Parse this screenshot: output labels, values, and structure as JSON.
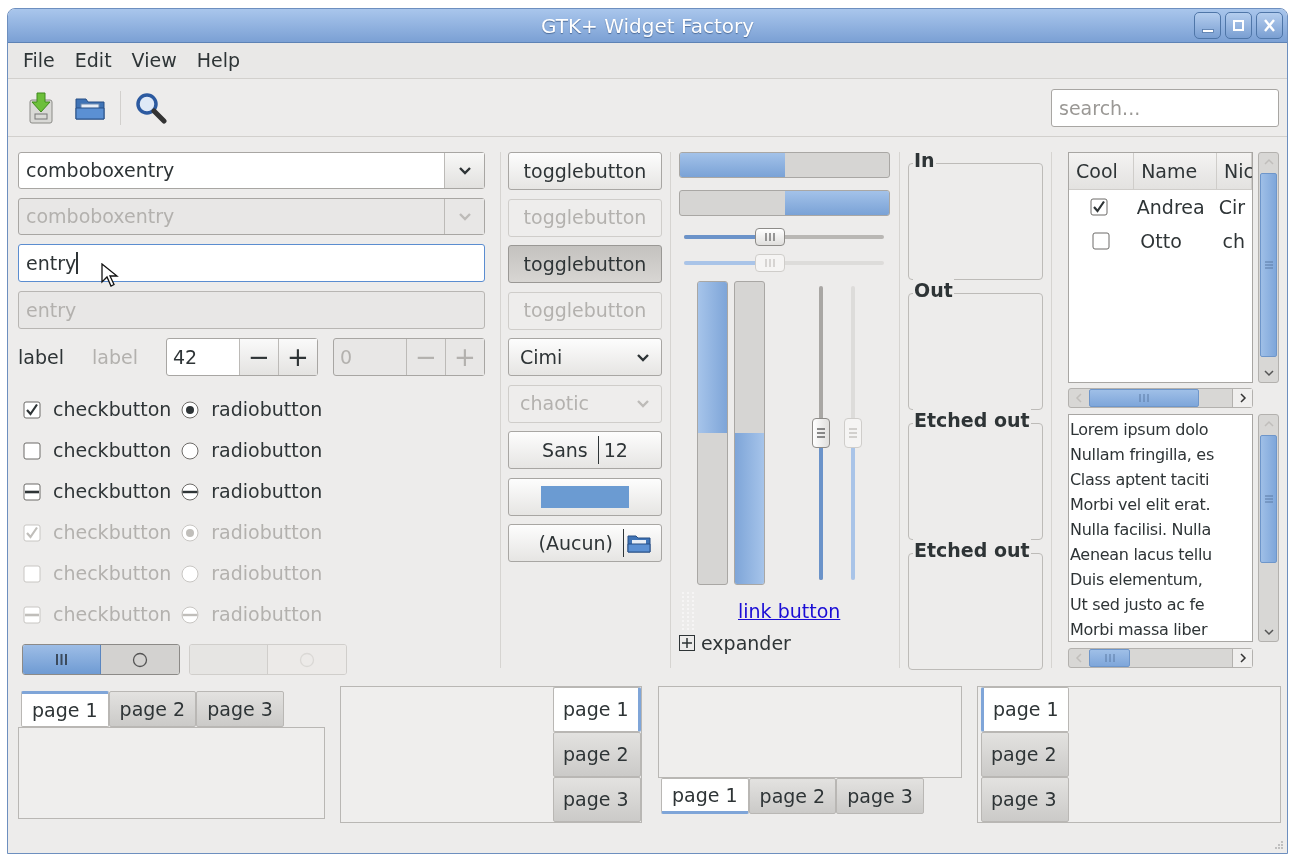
{
  "window": {
    "title": "GTK+ Widget Factory"
  },
  "menu": [
    "File",
    "Edit",
    "View",
    "Help"
  ],
  "toolbar": {
    "search": {
      "placeholder": "search..."
    }
  },
  "combo_entries": [
    {
      "value": "comboboxentry",
      "disabled": false
    },
    {
      "value": "comboboxentry",
      "disabled": true
    }
  ],
  "entries": [
    {
      "value": "entry",
      "disabled": false,
      "focused": true
    },
    {
      "value": "entry",
      "disabled": true,
      "focused": false
    }
  ],
  "labels": [
    {
      "text": "label",
      "disabled": false
    },
    {
      "text": "label",
      "disabled": true
    }
  ],
  "spin_buttons": [
    {
      "value": "42",
      "minus": "−",
      "plus": "+",
      "disabled": false
    },
    {
      "value": "0",
      "minus": "−",
      "plus": "+",
      "disabled": true
    }
  ],
  "check_rows": [
    {
      "check": {
        "label": "checkbutton",
        "checked": true,
        "inconsistent": false
      },
      "radio": {
        "label": "radiobutton",
        "checked": true,
        "inconsistent": false
      },
      "disabled": false
    },
    {
      "check": {
        "label": "checkbutton",
        "checked": false,
        "inconsistent": false
      },
      "radio": {
        "label": "radiobutton",
        "checked": false,
        "inconsistent": false
      },
      "disabled": false
    },
    {
      "check": {
        "label": "checkbutton",
        "inconsistent": true
      },
      "radio": {
        "label": "radiobutton",
        "inconsistent": true
      },
      "disabled": false
    },
    {
      "check": {
        "label": "checkbutton",
        "checked": true,
        "inconsistent": false
      },
      "radio": {
        "label": "radiobutton",
        "checked": true,
        "inconsistent": false
      },
      "disabled": true
    },
    {
      "check": {
        "label": "checkbutton",
        "checked": false,
        "inconsistent": false
      },
      "radio": {
        "label": "radiobutton",
        "checked": false,
        "inconsistent": false
      },
      "disabled": true
    },
    {
      "check": {
        "label": "checkbutton",
        "inconsistent": true
      },
      "radio": {
        "label": "radiobutton",
        "inconsistent": true
      },
      "disabled": true
    }
  ],
  "switches": [
    {
      "on": true,
      "disabled": false
    },
    {
      "on": false,
      "disabled": true
    }
  ],
  "toggle_buttons": [
    {
      "label": "togglebutton",
      "active": false,
      "disabled": false
    },
    {
      "label": "togglebutton",
      "active": false,
      "disabled": true
    },
    {
      "label": "togglebutton",
      "active": true,
      "disabled": false
    },
    {
      "label": "togglebutton",
      "active": false,
      "disabled": true
    }
  ],
  "combos": [
    {
      "value": "Cimi",
      "disabled": false
    },
    {
      "value": "chaotic",
      "disabled": true
    }
  ],
  "font_button": {
    "family": "Sans",
    "size": "12"
  },
  "color_button": {
    "color": "#6b9bd2"
  },
  "file_button": {
    "label": "(Aucun)"
  },
  "progress_bars": [
    {
      "level": 0.5,
      "inverted": false
    },
    {
      "level": 0.5,
      "inverted": true
    }
  ],
  "scales": [
    {
      "level": 0.43,
      "disabled": false
    },
    {
      "level": 0.43,
      "disabled": true
    }
  ],
  "vertical_progress_bars": [
    {
      "level": 0.5,
      "inverted": true
    },
    {
      "level": 0.5,
      "inverted": false
    }
  ],
  "vertical_scales": [
    {
      "level": 0.5,
      "disabled": false
    },
    {
      "level": 0.5,
      "disabled": true
    }
  ],
  "link_button": "link button",
  "expander": {
    "label": "expander",
    "expanded": false
  },
  "frames": [
    {
      "label": "In"
    },
    {
      "label": "Out"
    },
    {
      "label": "Etched out"
    },
    {
      "label": "Etched out"
    }
  ],
  "tree": {
    "columns": [
      "Cool",
      "Name",
      "Nic"
    ],
    "rows": [
      {
        "cool": true,
        "name": "Andrea",
        "nick": "Cir"
      },
      {
        "cool": false,
        "name": "Otto",
        "nick": "ch"
      }
    ]
  },
  "text_view": [
    "Lorem ipsum dolo",
    "Nullam fringilla, es",
    "Class aptent taciti",
    "Morbi vel elit erat.",
    "Nulla facilisi. Nulla",
    "Aenean lacus tellu",
    "Duis elementum,",
    "Ut sed justo ac fe",
    "Morbi massa liber"
  ],
  "notebooks": [
    {
      "kind": "top",
      "tabs": [
        {
          "label": "page 1",
          "selected": true
        },
        {
          "label": "page 2",
          "selected": false
        },
        {
          "label": "page 3",
          "selected": false
        }
      ]
    },
    {
      "kind": "right",
      "tabs": [
        {
          "label": "page 1",
          "selected": true
        },
        {
          "label": "page 2",
          "selected": false
        },
        {
          "label": "page 3",
          "selected": false
        }
      ]
    },
    {
      "kind": "bottom",
      "tabs": [
        {
          "label": "page 1",
          "selected": true
        },
        {
          "label": "page 2",
          "selected": false
        },
        {
          "label": "page 3",
          "selected": false
        }
      ]
    },
    {
      "kind": "left",
      "tabs": [
        {
          "label": "page 1",
          "selected": true
        },
        {
          "label": "page 2",
          "selected": false
        },
        {
          "label": "page 3",
          "selected": false
        }
      ]
    }
  ]
}
